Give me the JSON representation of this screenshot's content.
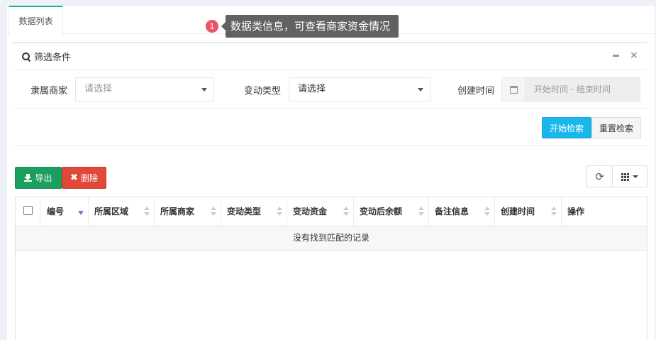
{
  "tabs": [
    {
      "label": "数据列表"
    }
  ],
  "tooltip": {
    "badge": "1",
    "text": "数据类信息，可查看商家资金情况"
  },
  "filter": {
    "title": "筛选条件",
    "merchant_label": "隶属商家",
    "merchant_placeholder": "请选择",
    "type_label": "变动类型",
    "type_value": "请选择",
    "time_label": "创建时间",
    "time_placeholder": "开始时间 - 结束时间",
    "search_button": "开始检索",
    "reset_button": "重置检索"
  },
  "toolbar": {
    "export_label": "导出",
    "delete_label": "删除"
  },
  "table": {
    "columns": [
      "编号",
      "所属区域",
      "所属商家",
      "变动类型",
      "变动资金",
      "变动后余额",
      "备注信息",
      "创建时间",
      "操作"
    ],
    "empty_text": "没有找到匹配的记录"
  },
  "colors": {
    "primary": "#1ab7ea",
    "success": "#1c9e5e",
    "danger": "#e0493a",
    "tab_accent": "#1ab394",
    "badge": "#ed5565"
  }
}
